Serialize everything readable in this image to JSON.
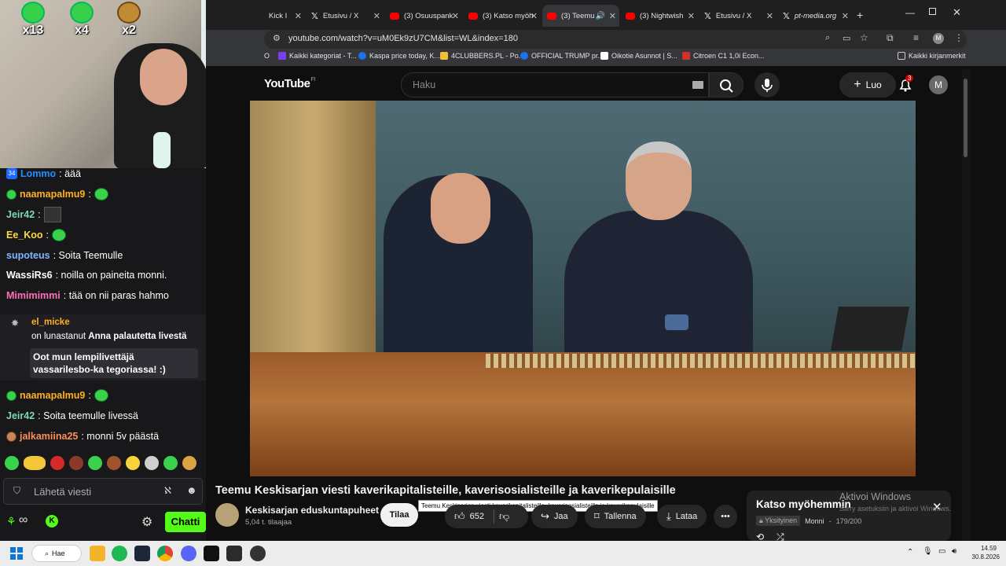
{
  "webcam": {
    "emote_counters": [
      {
        "label": "x13"
      },
      {
        "label": "x4"
      },
      {
        "label": "x2"
      }
    ]
  },
  "chat": {
    "messages": [
      {
        "badge": "34",
        "user": "Lommo",
        "user_color": "#1e90ff",
        "text": ": äää"
      },
      {
        "user": "naamapalmu9",
        "user_color": "#ffb020",
        "text": ":"
      },
      {
        "user": "Jeir42",
        "user_color": "#7fd9b0",
        "text": ":"
      },
      {
        "user": "Ee_Koo",
        "user_color": "#ffd93d",
        "text": ":"
      },
      {
        "user": "supoteus",
        "user_color": "#7fb6ff",
        "text": ": Soita Teemulle"
      },
      {
        "user": "WassiRs6",
        "user_color": "#ffffff",
        "text": ": noilla on paineita monni."
      },
      {
        "user": "Mimimimmi",
        "user_color": "#ff6fb3",
        "text": ": tää on nii paras hahmo"
      },
      {
        "user": "naamapalmu9",
        "user_color": "#ffb020",
        "text": ":"
      },
      {
        "user": "Jeir42",
        "user_color": "#7fd9b0",
        "text": ": Soita teemulle livessä"
      },
      {
        "user": "jalkamiina25",
        "user_color": "#ff8c5a",
        "text": ": monni 5v päästä"
      }
    ],
    "redeem": {
      "user": "el_micke",
      "user_color": "#ffb020",
      "action_prefix": "on lunastanut",
      "reward": "Anna palautetta livestä",
      "message": "Oot mun lempilivettäjä vassarilesbo-ka tegoriassa! :)"
    },
    "input_placeholder": "Lähetä viesti",
    "send_label": "Chatti"
  },
  "browser": {
    "tabs": [
      {
        "label": "Kick I",
        "icon": "kick-icon",
        "active": false
      },
      {
        "label": "Etusivu / X",
        "icon": "x-logo-icon",
        "active": false
      },
      {
        "label": "(3) Osuuspank",
        "icon": "youtube-icon",
        "active": false
      },
      {
        "label": "(3) Katso myöh",
        "icon": "youtube-icon",
        "active": false
      },
      {
        "label": "(3) Teemu",
        "icon": "youtube-icon",
        "active": true
      },
      {
        "label": "(3) Nightwish",
        "icon": "youtube-icon",
        "active": false
      },
      {
        "label": "Etusivu / X",
        "icon": "x-logo-icon",
        "active": false
      },
      {
        "label": "pt-media.org",
        "icon": "x-logo-icon",
        "active": false
      }
    ],
    "url": "youtube.com/watch?v=uM0Ek9zU7CM&list=WL&index=180",
    "bookmarks": [
      {
        "label": "Kaikki kategoriat - T...",
        "color": "#7b3ff2"
      },
      {
        "label": "Kaspa price today, K...",
        "color": "#1a73e8"
      },
      {
        "label": "4CLUBBERS.PL - Po...",
        "color": "#f2c037"
      },
      {
        "label": "OFFICIAL TRUMP pr...",
        "color": "#1a73e8"
      },
      {
        "label": "Oikotie Asunnot | S...",
        "color": "#ffffff"
      },
      {
        "label": "Citroen C1 1,0i Econ...",
        "color": "#d32f2f"
      }
    ],
    "all_bookmarks": "Kaikki kirjanmerkit",
    "profile_letter": "M"
  },
  "youtube": {
    "logo": "YouTube",
    "region": "FI",
    "search_placeholder": "Haku",
    "create_label": "Luo",
    "notifications": "3",
    "avatar_letter": "M",
    "video_title": "Teemu Keskisarjan viesti kaverikapitalisteille, kaverisosialisteille ja kaverikepulaisille",
    "tooltip": "Teemu Keskisarjan viesti kaverikapitalisteille, kaverisosialisteille ja kaverikepulaisille",
    "channel_name": "Keskisarjan eduskuntapuheet",
    "subscribers": "5,04 t. tilaajaa",
    "subscribe_label": "Tilaa",
    "likes": "652",
    "share_label": "Jaa",
    "save_label": "Tallenna",
    "download_label": "Lataa",
    "playlist_title": "Katso myöhemmin",
    "playlist_privacy": "Yksityinen",
    "playlist_owner": "Monni",
    "playlist_position": "179/200",
    "activate_title": "Aktivoi Windows",
    "activate_sub": "Siirry asetuksiin ja aktivoi Windows."
  },
  "taskbar": {
    "search_label": "Hae",
    "time": "14.59",
    "date": "30.8.2026"
  }
}
